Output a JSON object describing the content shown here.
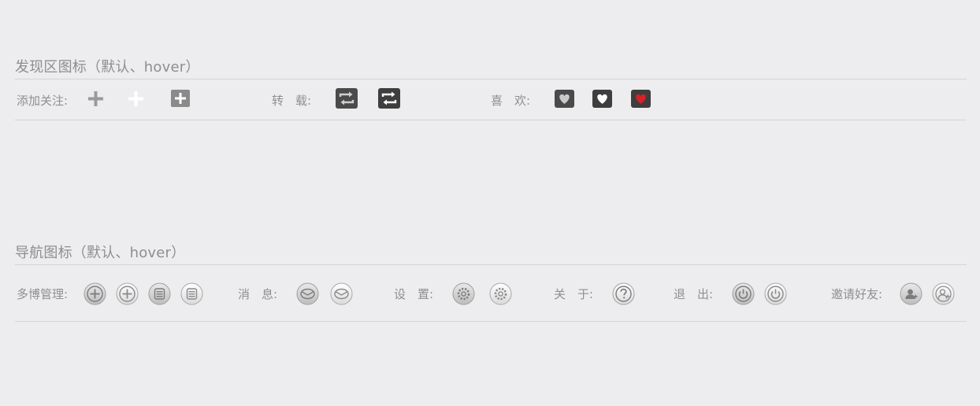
{
  "discover": {
    "title": "发现区图标（默认、hover）",
    "follow_label": "添加关注:",
    "repost_label": "转　载:",
    "like_label": "喜　欢:",
    "icons": {
      "follow": [
        "plus-icon",
        "plus-icon-hover",
        "plus-box-icon"
      ],
      "repost": [
        "repost-icon",
        "repost-icon-hover"
      ],
      "like": [
        "heart-icon",
        "heart-icon-hover",
        "heart-icon-active"
      ]
    },
    "colors": {
      "dark_tile": "#4a4a4a",
      "like_red": "#d6202a",
      "plus_gray": "#9a9a9a",
      "plus_box": "#8a8a8a"
    }
  },
  "nav": {
    "title": "导航图标（默认、hover）",
    "weibo_label": "多博管理:",
    "message_label": "消　息:",
    "settings_label": "设　置:",
    "about_label": "关　于:",
    "logout_label": "退　出:",
    "invite_label": "邀请好友:",
    "icons": {
      "weibo": [
        "circle-plus-icon",
        "circle-plus-icon-hover",
        "circle-list-icon",
        "circle-list-icon-hover"
      ],
      "message": [
        "mail-icon",
        "mail-icon-hover"
      ],
      "settings": [
        "gear-icon",
        "gear-icon-hover"
      ],
      "about": [
        "question-icon"
      ],
      "logout": [
        "power-icon",
        "power-icon-hover"
      ],
      "invite": [
        "user-add-icon",
        "user-add-icon-hover"
      ]
    }
  }
}
